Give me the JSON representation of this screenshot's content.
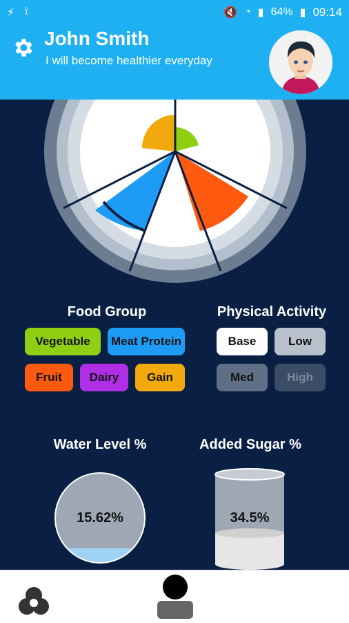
{
  "status_bar": {
    "battery": "64%",
    "time": "09:14"
  },
  "header": {
    "name": "John Smith",
    "tagline": "I will become healthier everyday"
  },
  "food_group": {
    "title": "Food Group",
    "chips": [
      {
        "label": "Vegetable",
        "color": "#8fcf13"
      },
      {
        "label": "Meat Protein",
        "color": "#1e9bf5"
      },
      {
        "label": "Fruit",
        "color": "#ff5a10"
      },
      {
        "label": "Dairy",
        "color": "#b02ee6"
      },
      {
        "label": "Gain",
        "color": "#f2a90c"
      }
    ]
  },
  "physical_activity": {
    "title": "Physical Activity",
    "levels": [
      {
        "label": "Base",
        "state": "selected"
      },
      {
        "label": "Low",
        "state": "normal"
      },
      {
        "label": "Med",
        "state": "dim"
      },
      {
        "label": "High",
        "state": "disabled"
      }
    ]
  },
  "water": {
    "title": "Water Level %",
    "value": "15.62%",
    "fill_fraction": 0.1562
  },
  "sugar": {
    "title": "Added Sugar %",
    "value": "34.5%",
    "fill_fraction": 0.345
  },
  "icons": {
    "settings": "gear-icon",
    "nav_left": "food-group-icon",
    "nav_center": "profile-icon"
  }
}
